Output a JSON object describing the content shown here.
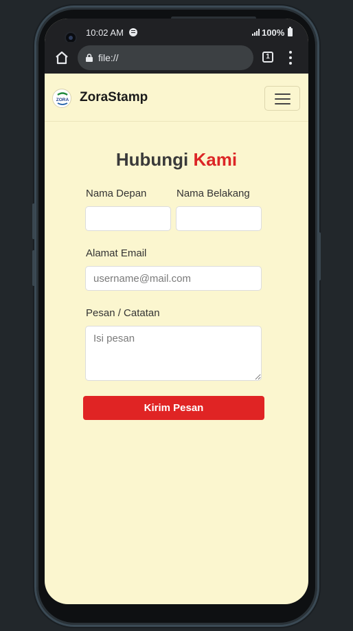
{
  "status_bar": {
    "time": "10:02 AM",
    "battery": "100%"
  },
  "browser": {
    "url": "file://",
    "tab_count": "1"
  },
  "navbar": {
    "brand": "ZoraStamp",
    "logo_text": "ZORA"
  },
  "contact": {
    "title_main": "Hubungi",
    "title_accent": "Kami",
    "first_name_label": "Nama Depan",
    "last_name_label": "Nama Belakang",
    "email_label": "Alamat Email",
    "email_placeholder": "username@mail.com",
    "message_label": "Pesan / Catatan",
    "message_placeholder": "Isi pesan",
    "submit_label": "Kirim Pesan"
  },
  "colors": {
    "accent": "#dc2626",
    "page_bg": "#fbf6cf",
    "button": "#e02424"
  }
}
